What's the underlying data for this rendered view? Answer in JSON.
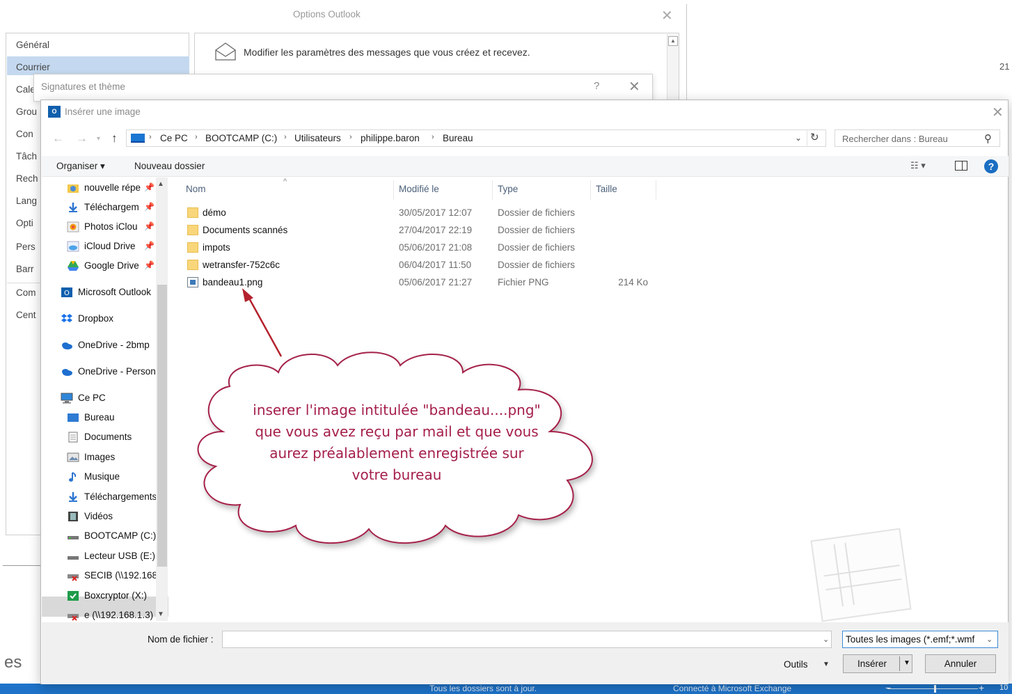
{
  "options_window": {
    "title": "Options Outlook",
    "close_glyph": "✕",
    "nav_items": [
      "Général",
      "Courrier",
      "Cale",
      "Grou",
      "Con",
      "Tâch",
      "Rech",
      "Lang",
      "Opti",
      "Pers",
      "Barr",
      "Com",
      "Cent"
    ],
    "content_text": "Modifier les paramètres des messages que vous créez et recevez."
  },
  "right_number": "21",
  "bottom_text": "es",
  "signatures_window": {
    "title": "Signatures et thème",
    "help_glyph": "?",
    "close_glyph": "✕"
  },
  "dialog": {
    "title": "Insérer une image",
    "app_icon_text": "O",
    "close_glyph": "✕",
    "breadcrumb": [
      "Ce PC",
      "BOOTCAMP (C:)",
      "Utilisateurs",
      "philippe.baron",
      "Bureau"
    ],
    "search_placeholder": "Rechercher dans : Bureau",
    "toolbar": {
      "organize": "Organiser ▾",
      "new_folder": "Nouveau dossier",
      "view": "☷ ▾",
      "help": "?"
    },
    "nav_items": [
      {
        "label": "nouvelle répe",
        "icon": "folder-icon",
        "pinned": true
      },
      {
        "label": "Téléchargem",
        "icon": "download-icon",
        "pinned": true
      },
      {
        "label": "Photos iClou",
        "icon": "photos-icon",
        "pinned": true
      },
      {
        "label": "iCloud Drive",
        "icon": "icloud-icon",
        "pinned": true
      },
      {
        "label": "Google Drive",
        "icon": "google-drive-icon",
        "pinned": true
      },
      {
        "label": "Microsoft Outlook",
        "icon": "outlook-icon",
        "pinned": false
      },
      {
        "label": "Dropbox",
        "icon": "dropbox-icon",
        "pinned": false
      },
      {
        "label": "OneDrive - 2bmp",
        "icon": "onedrive-icon",
        "pinned": false
      },
      {
        "label": "OneDrive - Person",
        "icon": "onedrive-icon",
        "pinned": false
      },
      {
        "label": "Ce PC",
        "icon": "computer-icon",
        "pinned": false
      },
      {
        "label": "Bureau",
        "icon": "desktop-icon",
        "pinned": false
      },
      {
        "label": "Documents",
        "icon": "documents-icon",
        "pinned": false
      },
      {
        "label": "Images",
        "icon": "images-icon",
        "pinned": false
      },
      {
        "label": "Musique",
        "icon": "music-icon",
        "pinned": false
      },
      {
        "label": "Téléchargements",
        "icon": "download-icon",
        "pinned": false
      },
      {
        "label": "Vidéos",
        "icon": "videos-icon",
        "pinned": false
      },
      {
        "label": "BOOTCAMP (C:)",
        "icon": "drive-icon",
        "pinned": false
      },
      {
        "label": "Lecteur USB (E:)",
        "icon": "usb-drive-icon",
        "pinned": false
      },
      {
        "label": "SECIB (\\\\192.168",
        "icon": "network-drive-icon",
        "pinned": false
      },
      {
        "label": "Boxcryptor (X:)",
        "icon": "boxcryptor-icon",
        "pinned": false
      },
      {
        "label": "e (\\\\192.168.1.3)",
        "icon": "network-drive-icon",
        "pinned": false
      }
    ],
    "columns": [
      "Nom",
      "Modifié le",
      "Type",
      "Taille"
    ],
    "files": [
      {
        "name": "démo",
        "modified": "30/05/2017 12:07",
        "type": "Dossier de fichiers",
        "size": ""
      },
      {
        "name": "Documents scannés",
        "modified": "27/04/2017 22:19",
        "type": "Dossier de fichiers",
        "size": ""
      },
      {
        "name": "impots",
        "modified": "05/06/2017 21:08",
        "type": "Dossier de fichiers",
        "size": ""
      },
      {
        "name": "wetransfer-752c6c",
        "modified": "06/04/2017 11:50",
        "type": "Dossier de fichiers",
        "size": ""
      },
      {
        "name": "bandeau1.png",
        "modified": "05/06/2017 21:27",
        "type": "Fichier PNG",
        "size": "214 Ko"
      }
    ],
    "filename_label": "Nom de fichier :",
    "filename_value": "",
    "filter_value": "Toutes les images (*.emf;*.wmf",
    "tools_label": "Outils",
    "insert_label": "Insérer",
    "cancel_label": "Annuler"
  },
  "annotation": {
    "lines": [
      "inserer l'image intitulée \"bandeau....png\"",
      "que vous avez reçu par mail et que vous",
      "aurez préalablement enregistrée sur",
      "votre bureau"
    ],
    "color": "#a5204a"
  },
  "status_bar": {
    "left_text": "Tous les dossiers sont à jour.",
    "right_text": "Connecté à Microsoft Exchange",
    "zoom_minus": "−",
    "zoom_plus": "+",
    "zoom_text": "10"
  },
  "colors": {
    "accent": "#1b6ec2",
    "selection": "#c4d9ef",
    "status_bar": "#1e73c9"
  }
}
